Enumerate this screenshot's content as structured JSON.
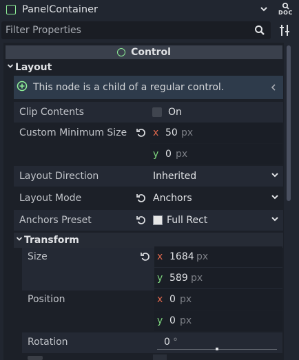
{
  "node": {
    "name": "PanelContainer"
  },
  "doc_label": "DOC",
  "filter": {
    "placeholder": "Filter Properties"
  },
  "section": {
    "title": "Control"
  },
  "layout": {
    "title": "Layout",
    "info": "This node is a child of a regular control.",
    "clip_contents": {
      "label": "Clip Contents",
      "value": "On"
    },
    "custom_min_size": {
      "label": "Custom Minimum Size",
      "x": "50",
      "y": "0",
      "unit": "px"
    },
    "layout_direction": {
      "label": "Layout Direction",
      "value": "Inherited"
    },
    "layout_mode": {
      "label": "Layout Mode",
      "value": "Anchors"
    },
    "anchors_preset": {
      "label": "Anchors Preset",
      "value": "Full Rect"
    }
  },
  "transform": {
    "title": "Transform",
    "size": {
      "label": "Size",
      "x": "1684",
      "y": "589",
      "unit": "px"
    },
    "position": {
      "label": "Position",
      "x": "0",
      "y": "0",
      "unit": "px"
    },
    "rotation": {
      "label": "Rotation",
      "value": "0",
      "unit": "°"
    }
  },
  "axis": {
    "x": "x",
    "y": "y"
  },
  "colors": {
    "accent_green": "#8eef97",
    "axis_x": "#e0684d",
    "axis_y": "#7ed67e"
  }
}
